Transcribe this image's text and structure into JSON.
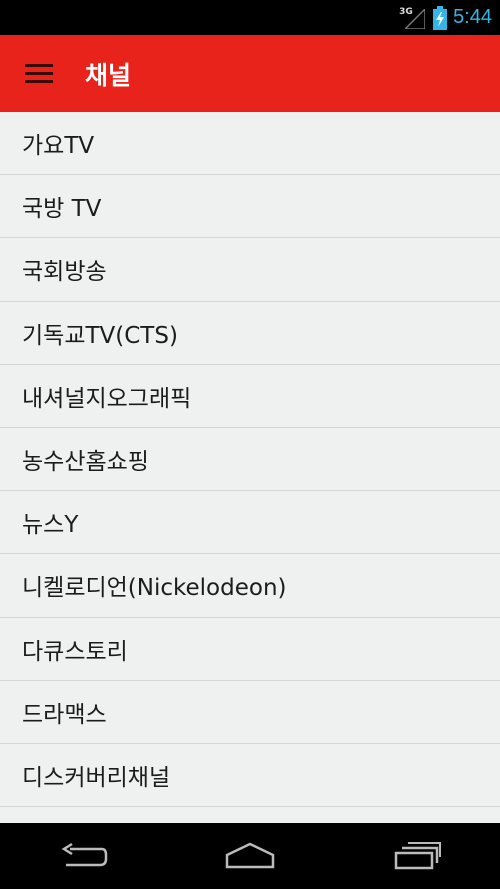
{
  "status_bar": {
    "network_type": "3G",
    "time": "5:44",
    "icons": [
      "signal-icon",
      "battery-charging-icon"
    ]
  },
  "app_bar": {
    "title": "채널",
    "menu_icon": "hamburger-menu-icon",
    "color": "#e8231c"
  },
  "channels": [
    {
      "label": "가요TV"
    },
    {
      "label": "국방 TV"
    },
    {
      "label": "국회방송"
    },
    {
      "label": "기독교TV(CTS)"
    },
    {
      "label": "내셔널지오그래픽"
    },
    {
      "label": "농수산홈쇼핑"
    },
    {
      "label": "뉴스Y"
    },
    {
      "label": "니켈로디언(Nickelodeon)"
    },
    {
      "label": "다큐스토리"
    },
    {
      "label": "드라맥스"
    },
    {
      "label": "디스커버리채널"
    }
  ],
  "nav_bar": {
    "icons": [
      "back-icon",
      "home-icon",
      "recent-apps-icon"
    ]
  }
}
